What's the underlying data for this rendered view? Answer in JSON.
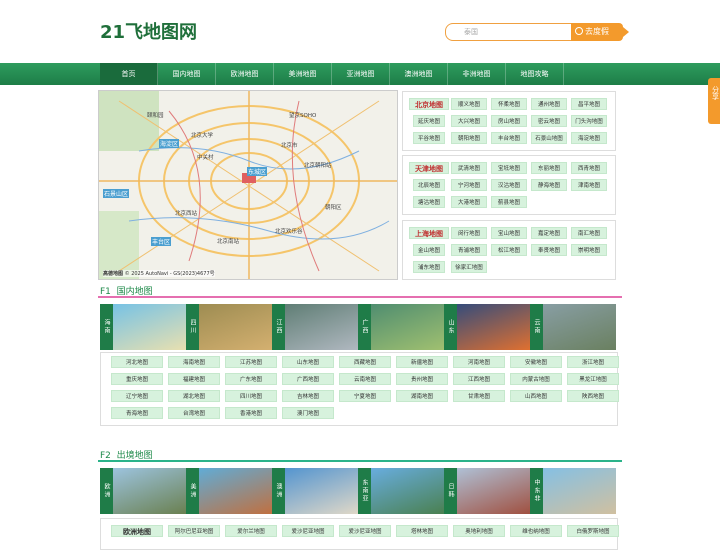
{
  "logo": "21飞地图网",
  "search": {
    "placeholder": "泰国",
    "button": "去度假"
  },
  "nav": [
    "首页",
    "国内地图",
    "欧洲地图",
    "美洲地图",
    "亚洲地图",
    "澳洲地图",
    "非洲地图",
    "地图攻略"
  ],
  "share": "分享",
  "map": {
    "copyright": "© 2025 AutoNavi - GS(2023)4677号",
    "logo": "高德地图",
    "labels": [
      {
        "t": "海淀区",
        "k": "blue"
      },
      {
        "t": "石景山区",
        "k": "blue"
      },
      {
        "t": "丰台区",
        "k": "blue"
      },
      {
        "t": "东城区",
        "k": "blue"
      },
      {
        "t": "颐和园",
        "k": "plain"
      },
      {
        "t": "望京SOHO",
        "k": "plain"
      },
      {
        "t": "北京朝阳站",
        "k": "plain"
      },
      {
        "t": "北京西站",
        "k": "plain"
      },
      {
        "t": "北京南站",
        "k": "plain"
      },
      {
        "t": "北京欢乐谷",
        "k": "plain"
      },
      {
        "t": "北京大学",
        "k": "plain"
      },
      {
        "t": "北京市",
        "k": "plain"
      },
      {
        "t": "朝阳区",
        "k": "plain"
      },
      {
        "t": "中关村",
        "k": "plain"
      }
    ]
  },
  "beijing": {
    "title": "北京地图",
    "items": [
      "顺义地图",
      "怀柔地图",
      "通州地图",
      "昌平地图",
      "延庆地图",
      "大兴地图",
      "房山地图",
      "密云地图",
      "门头沟地图",
      "平谷地图",
      "朝阳地图",
      "丰台地图",
      "石景山地图",
      "海淀地图"
    ]
  },
  "tianjin": {
    "title": "天津地图",
    "items": [
      "武清地图",
      "宝坻地图",
      "东丽地图",
      "西青地图",
      "北辰地图",
      "宁河地图",
      "汉沽地图",
      "静海地图",
      "津南地图",
      "塘沽地图",
      "大港地图",
      "蓟县地图"
    ]
  },
  "shanghai": {
    "title": "上海地图",
    "items": [
      "闵行地图",
      "宝山地图",
      "嘉定地图",
      "南汇地图",
      "金山地图",
      "青浦地图",
      "松江地图",
      "奉贤地图",
      "崇明地图",
      "浦东地图",
      "徐家汇地图"
    ]
  },
  "f1": {
    "prefix": "F1",
    "title": "国内地图",
    "photos": [
      "海南",
      "四川",
      "江西",
      "广西",
      "山东",
      "云南"
    ],
    "items": [
      "河北地图",
      "海南地图",
      "江苏地图",
      "山东地图",
      "西藏地图",
      "新疆地图",
      "河南地图",
      "安徽地图",
      "浙江地图",
      "重庆地图",
      "福建地图",
      "广东地图",
      "广西地图",
      "云南地图",
      "贵州地图",
      "江西地图",
      "内蒙古地图",
      "黑龙江地图",
      "辽宁地图",
      "湖北地图",
      "四川地图",
      "吉林地图",
      "宁夏地图",
      "湖南地图",
      "甘肃地图",
      "山西地图",
      "陕西地图",
      "青海地图",
      "台湾地图",
      "香港地图",
      "澳门地图"
    ]
  },
  "f2": {
    "prefix": "F2",
    "title": "出境地图",
    "photos": [
      "欧洲",
      "美洲",
      "澳洲",
      "东南亚",
      "日韩",
      "中东非"
    ],
    "head": "欧洲地图",
    "items": [
      "阿尔巴尼亚地图",
      "爱尔兰地图",
      "爱沙尼亚地图",
      "爱沙尼亚地图",
      "塔林地图",
      "奥地利地图",
      "维也纳地图",
      "白俄罗斯地图"
    ]
  },
  "colors": {
    "green": "#1f7c48",
    "tag": "#d7f2dd",
    "orange": "#f39a2c",
    "pink": "#e56fb0",
    "red": "#c03030"
  }
}
